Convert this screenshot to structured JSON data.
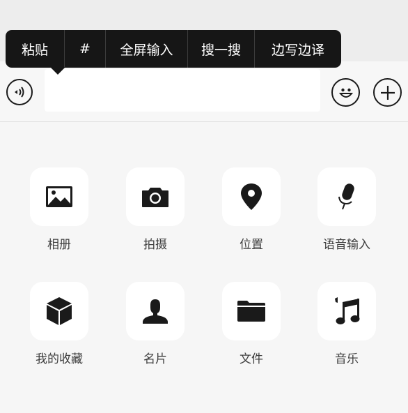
{
  "context_menu": {
    "items": [
      "粘贴",
      "#",
      "全屏输入",
      "搜一搜",
      "边写边译"
    ]
  },
  "input_bar": {
    "text_value": "",
    "voice_icon": "voice-icon",
    "emoji_icon": "emoji-icon",
    "plus_icon": "plus-icon"
  },
  "panel": {
    "tiles": [
      {
        "label": "相册",
        "icon": "photo-album-icon"
      },
      {
        "label": "拍摄",
        "icon": "camera-icon"
      },
      {
        "label": "位置",
        "icon": "location-pin-icon"
      },
      {
        "label": "语音输入",
        "icon": "microphone-icon"
      },
      {
        "label": "我的收藏",
        "icon": "favorites-cube-icon"
      },
      {
        "label": "名片",
        "icon": "contact-card-icon"
      },
      {
        "label": "文件",
        "icon": "folder-icon"
      },
      {
        "label": "音乐",
        "icon": "music-note-icon"
      }
    ]
  },
  "colors": {
    "menu_background": "#161616",
    "tile_background": "#ffffff",
    "page_background": "#f6f6f6",
    "icon_color": "#1a1a1a"
  }
}
